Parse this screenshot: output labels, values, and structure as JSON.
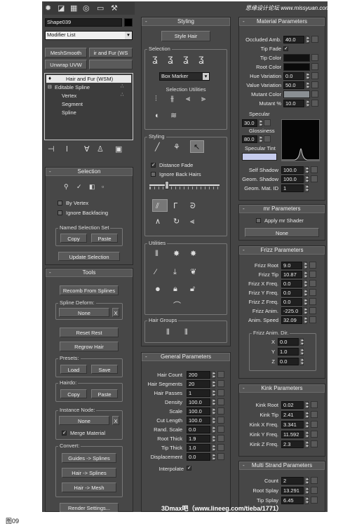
{
  "watermark_top": "思缘设计论坛 www.missyuan.com",
  "watermark_bottom": "3Dmax吧（www.lineeg.com/tieba/1771）",
  "figure_caption": "图09",
  "colors": {
    "panel_bg": "#474747",
    "field_bg": "#1f1f1f",
    "title_bg": "#565656",
    "accent_check": "#ffffff"
  },
  "left": {
    "tab_icons": [
      "create-icon",
      "modify-icon",
      "hierarchy-icon",
      "motion-icon",
      "display-icon",
      "utilities-icon"
    ],
    "object_name": "Shape039",
    "modifier_list": "Modifier List",
    "buttons": {
      "meshsmooth": "MeshSmooth",
      "hair_and_fur": "ir and Fur (WS",
      "unwrap": "Unwrap UVW"
    },
    "stack": [
      "Hair and Fur (WSM)",
      "Editable Spline",
      "Vertex",
      "Segment",
      "Spline"
    ],
    "selection_title": "Selection",
    "by_vertex": "By Vertex",
    "ignore_backfacing": "Ignore Backfacing",
    "named_selection_set": "Named Selection Set",
    "copy": "Copy",
    "paste": "Paste",
    "update_selection": "Update Selection",
    "tools_title": "Tools",
    "recomb": "Recomb From Splines",
    "spline_deform": "Spline Deform:",
    "none": "None",
    "x": "X",
    "reset_rest": "Reset Rest",
    "regrow_hair": "Regrow Hair",
    "presets": "Presets:",
    "load": "Load",
    "save": "Save",
    "hairdo": "Hairdo:",
    "instance_node": "Instance Node:",
    "merge_material": "Merge Material",
    "convert": "Convert:",
    "guides_splines": "Guides -> Splines",
    "hair_splines": "Hair -> Splines",
    "hair_mesh": "Hair -> Mesh",
    "render_settings": "Render Settings..."
  },
  "mid": {
    "styling_title": "Styling",
    "style_hair": "Style Hair",
    "selection_label": "Selection",
    "box_marker": "Box Marker",
    "selection_utilities": "Selection Utilities",
    "styling_label": "Styling",
    "distance_fade": "Distance Fade",
    "ignore_back_hairs": "Ignore Back Hairs",
    "utilities_label": "Utilities",
    "hair_groups_label": "Hair Groups",
    "general_title": "General Parameters",
    "general": [
      {
        "label": "Hair Count",
        "value": "200"
      },
      {
        "label": "Hair Segments",
        "value": "20"
      },
      {
        "label": "Hair Passes",
        "value": "1"
      },
      {
        "label": "Density",
        "value": "100.0"
      },
      {
        "label": "Scale",
        "value": "100.0"
      },
      {
        "label": "Cut Length",
        "value": "100.0"
      },
      {
        "label": "Rand. Scale",
        "value": "0.0"
      },
      {
        "label": "Root Thick",
        "value": "1.9"
      },
      {
        "label": "Tip Thick",
        "value": "1.0"
      },
      {
        "label": "Displacement",
        "value": "0.0"
      }
    ],
    "interpolate": "Interpolate"
  },
  "right": {
    "material_title": "Material Parameters",
    "occluded_amb_label": "Occluded Amb.",
    "occluded_amb": "40.0",
    "tip_fade": "Tip Fade",
    "tip_color": "Tip Color",
    "root_color": "Root Color",
    "hue_variation_label": "Hue Variation",
    "hue_variation": "0.0",
    "value_variation_label": "Value Variation",
    "value_variation": "50.0",
    "mutant_color": "Mutant Color",
    "mutant_pct_label": "Mutant %",
    "mutant_pct": "10.0",
    "specular_label": "Specular",
    "specular": "30.0",
    "glossiness_label": "Glossiness",
    "glossiness": "80.0",
    "specular_tint": "Specular Tint",
    "self_shadow_label": "Self Shadow",
    "self_shadow": "100.0",
    "geom_shadow_label": "Geom. Shadow",
    "geom_shadow": "100.0",
    "geom_mat_id_label": "Geom. Mat. ID",
    "geom_mat_id": "1",
    "mr_title": "mr Parameters",
    "apply_mr_shader": "Apply mr Shader",
    "none": "None",
    "frizz_title": "Frizz Parameters",
    "frizz": [
      {
        "label": "Frizz Root",
        "value": "9.0"
      },
      {
        "label": "Frizz Tip",
        "value": "10.87"
      },
      {
        "label": "Frizz X Freq.",
        "value": "0.0"
      },
      {
        "label": "Frizz Y Freq.",
        "value": "0.0"
      },
      {
        "label": "Frizz Z Freq.",
        "value": "0.0"
      },
      {
        "label": "Frizz Anim.",
        "value": "-225.0"
      },
      {
        "label": "Anim. Speed",
        "value": "32.09"
      }
    ],
    "frizz_anim_dir": "Frizz Anim. Dir.",
    "dir": [
      {
        "label": "X",
        "value": "0.0"
      },
      {
        "label": "Y",
        "value": "1.0"
      },
      {
        "label": "Z",
        "value": "0.0"
      }
    ],
    "kink_title": "Kink Parameters",
    "kink": [
      {
        "label": "Kink Root",
        "value": "0.02"
      },
      {
        "label": "Kink Tip",
        "value": "2.41"
      },
      {
        "label": "Kink X Freq.",
        "value": "3.341"
      },
      {
        "label": "Kink Y Freq.",
        "value": "11.592"
      },
      {
        "label": "Kink Z Freq.",
        "value": "2.3"
      }
    ],
    "multi_title": "Multi Strand Parameters",
    "multi": [
      {
        "label": "Count",
        "value": "2"
      },
      {
        "label": "Root Splay",
        "value": "13.291"
      },
      {
        "label": "Tip Splay",
        "value": "6.45"
      }
    ]
  }
}
